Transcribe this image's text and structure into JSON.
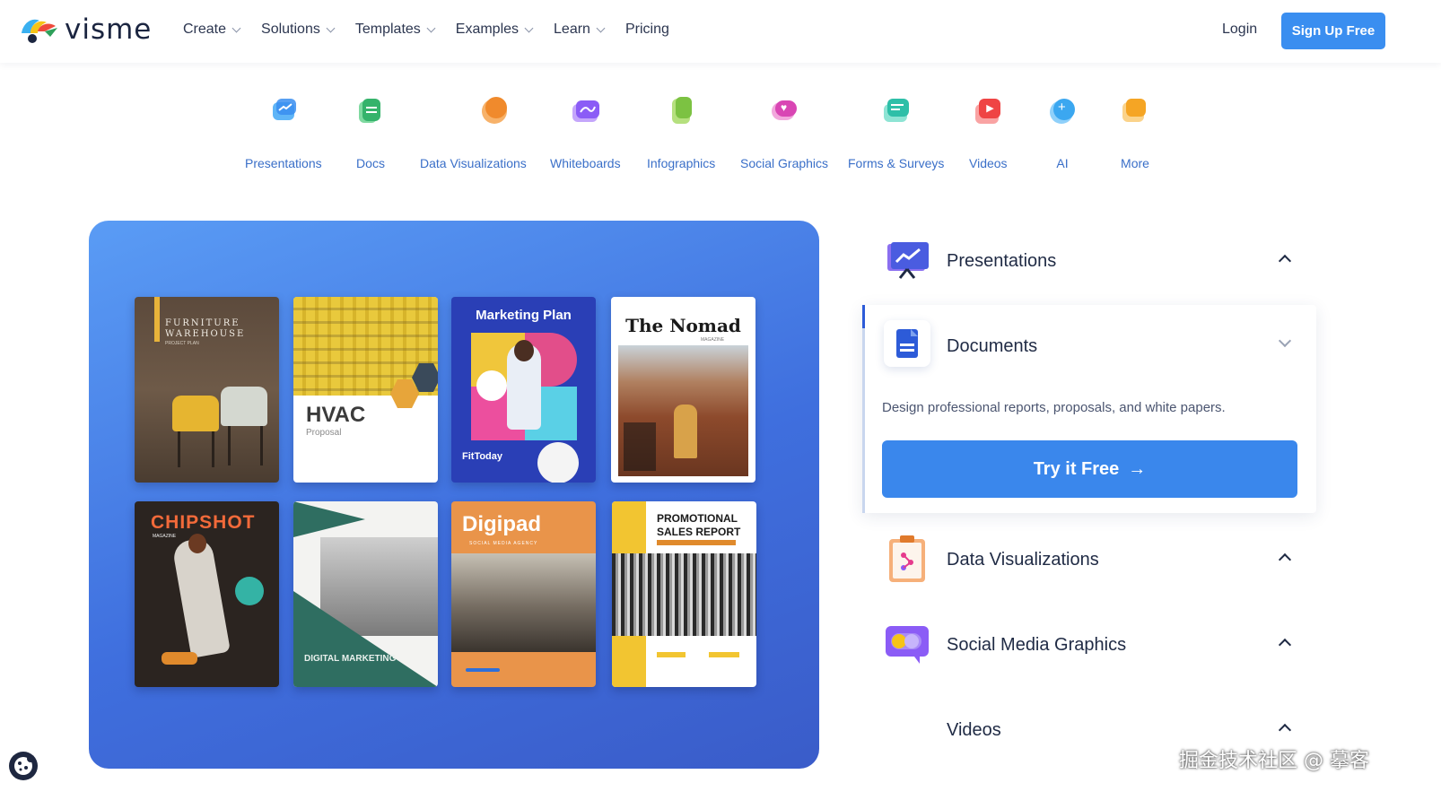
{
  "brand": {
    "name": "visme"
  },
  "nav": {
    "menu": [
      {
        "label": "Create"
      },
      {
        "label": "Solutions"
      },
      {
        "label": "Templates"
      },
      {
        "label": "Examples"
      },
      {
        "label": "Learn"
      },
      {
        "label": "Pricing"
      }
    ],
    "login": "Login",
    "signup": "Sign Up Free"
  },
  "categories": [
    {
      "label": "Presentations",
      "icon": "presentation-chart-icon",
      "color": "#3a8ef0"
    },
    {
      "label": "Docs",
      "icon": "document-icon",
      "color": "#35b36b"
    },
    {
      "label": "Data Visualizations",
      "icon": "pie-chart-icon",
      "color": "#f08a2c"
    },
    {
      "label": "Whiteboards",
      "icon": "whiteboard-icon",
      "color": "#8b5cf6"
    },
    {
      "label": "Infographics",
      "icon": "infographic-icon",
      "color": "#7cc242"
    },
    {
      "label": "Social Graphics",
      "icon": "heart-chat-icon",
      "color": "#d946b4"
    },
    {
      "label": "Forms & Surveys",
      "icon": "form-icon",
      "color": "#2ebfa8"
    },
    {
      "label": "Videos",
      "icon": "video-icon",
      "color": "#ef4444"
    },
    {
      "label": "AI",
      "icon": "ai-sparkle-icon",
      "color": "#3ba7f0"
    },
    {
      "label": "More",
      "icon": "more-icon",
      "color": "#f5a524"
    }
  ],
  "thumbnails": [
    {
      "title": "FURNITURE",
      "subtitle": "WAREHOUSE",
      "small": "PROJECT PLAN",
      "name": "furniture-warehouse-thumb"
    },
    {
      "title": "HVAC",
      "subtitle": "Proposal",
      "name": "hvac-proposal-thumb"
    },
    {
      "title": "Marketing Plan",
      "subtitle": "FitToday",
      "name": "marketing-plan-thumb"
    },
    {
      "title": "The Nomad",
      "subtitle": "MAGAZINE",
      "name": "nomad-magazine-thumb"
    },
    {
      "title": "CHIPSHOT",
      "subtitle": "MAGAZINE",
      "name": "chipshot-magazine-thumb"
    },
    {
      "title": "DIGITAL MARKETING",
      "name": "digital-marketing-thumb"
    },
    {
      "title": "Digipad",
      "subtitle": "SOCIAL MEDIA AGENCY",
      "name": "digipad-thumb"
    },
    {
      "title": "PROMOTIONAL",
      "subtitle": "SALES REPORT",
      "name": "sales-report-thumb"
    }
  ],
  "accordion": {
    "presentations": "Presentations",
    "documents": "Documents",
    "documents_desc": "Design professional reports, proposals, and white papers.",
    "try_free": "Try it Free",
    "try_arrow": "→",
    "data_viz": "Data Visualizations",
    "social": "Social Media Graphics",
    "videos": "Videos"
  },
  "watermark": "掘金技术社区 @ 摹客",
  "colors": {
    "accent": "#3a8ef0",
    "hero_top": "#5a9cf5",
    "hero_bottom": "#3a5cc9"
  }
}
